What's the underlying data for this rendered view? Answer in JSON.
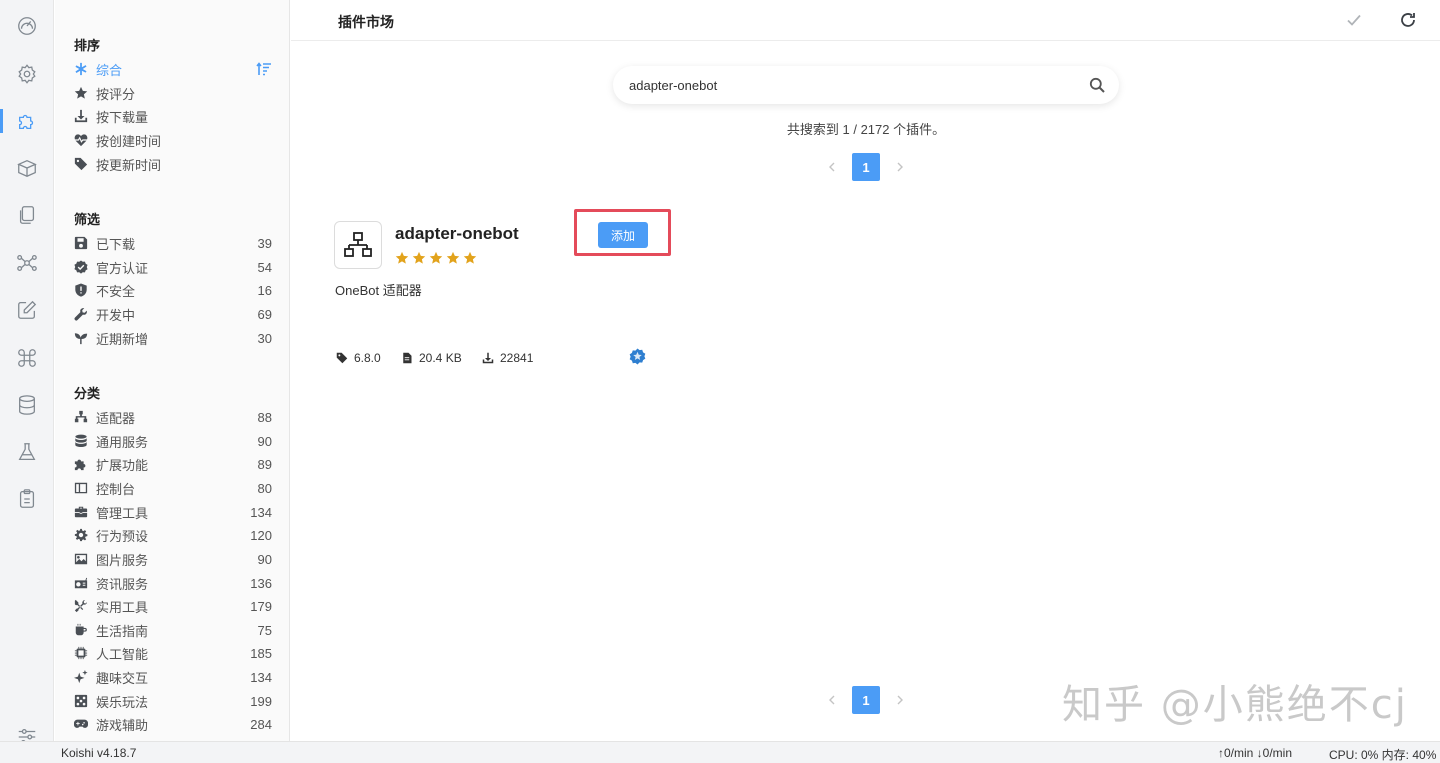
{
  "header": {
    "title": "插件市场"
  },
  "sidebar": {
    "sort": {
      "title": "排序",
      "items": [
        {
          "label": "综合"
        },
        {
          "label": "按评分"
        },
        {
          "label": "按下载量"
        },
        {
          "label": "按创建时间"
        },
        {
          "label": "按更新时间"
        }
      ]
    },
    "filter": {
      "title": "筛选",
      "items": [
        {
          "label": "已下载",
          "count": "39"
        },
        {
          "label": "官方认证",
          "count": "54"
        },
        {
          "label": "不安全",
          "count": "16"
        },
        {
          "label": "开发中",
          "count": "69"
        },
        {
          "label": "近期新增",
          "count": "30"
        }
      ]
    },
    "category": {
      "title": "分类",
      "items": [
        {
          "label": "适配器",
          "count": "88"
        },
        {
          "label": "通用服务",
          "count": "90"
        },
        {
          "label": "扩展功能",
          "count": "89"
        },
        {
          "label": "控制台",
          "count": "80"
        },
        {
          "label": "管理工具",
          "count": "134"
        },
        {
          "label": "行为预设",
          "count": "120"
        },
        {
          "label": "图片服务",
          "count": "90"
        },
        {
          "label": "资讯服务",
          "count": "136"
        },
        {
          "label": "实用工具",
          "count": "179"
        },
        {
          "label": "生活指南",
          "count": "75"
        },
        {
          "label": "人工智能",
          "count": "185"
        },
        {
          "label": "趣味交互",
          "count": "134"
        },
        {
          "label": "娱乐玩法",
          "count": "199"
        },
        {
          "label": "游戏辅助",
          "count": "284"
        }
      ]
    }
  },
  "search": {
    "value": "adapter-onebot"
  },
  "result_text": "共搜索到 1 / 2172 个插件。",
  "pagination": {
    "current": "1"
  },
  "plugin": {
    "name": "adapter-onebot",
    "rating": 5,
    "add_label": "添加",
    "description": "OneBot 适配器",
    "version": "6.8.0",
    "size": "20.4 KB",
    "downloads": "22841"
  },
  "watermark": "知乎 @小熊绝不cj",
  "statusbar": {
    "version": "Koishi v4.18.7",
    "network": "↑0/min ↓0/min",
    "resources": "CPU: 0% 内存: 40%"
  },
  "colors": {
    "accent": "#4b9cf6",
    "highlight": "#e44b5a",
    "star": "#e2a31c"
  }
}
